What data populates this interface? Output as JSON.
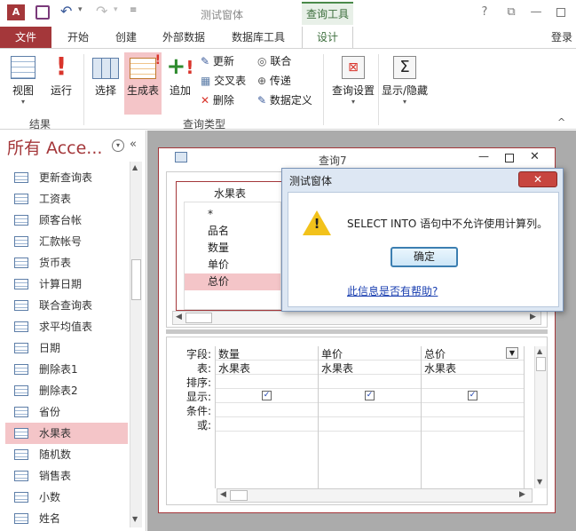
{
  "app": {
    "title": "测试窗体",
    "context_tab_group": "查询工具",
    "login": "登录"
  },
  "ribbon_tabs": [
    "文件",
    "开始",
    "创建",
    "外部数据",
    "数据库工具",
    "设计"
  ],
  "ribbon": {
    "results": {
      "label": "结果",
      "view": "视图",
      "run": "运行"
    },
    "query_type": {
      "label": "查询类型",
      "select": "选择",
      "make_table": "生成表",
      "append": "追加",
      "update": "更新",
      "crosstab": "交叉表",
      "delete": "删除",
      "union": "联合",
      "passthrough": "传递",
      "data_definition": "数据定义"
    },
    "query_setup": "查询设置",
    "show_hide": "显示/隐藏"
  },
  "nav": {
    "title": "所有 Acce...",
    "items": [
      "更新查询表",
      "工资表",
      "顾客台帐",
      "汇款帐号",
      "货币表",
      "计算日期",
      "联合查询表",
      "求平均值表",
      "日期",
      "删除表1",
      "删除表2",
      "省份",
      "水果表",
      "随机数",
      "销售表",
      "小数",
      "姓名"
    ],
    "selected": "水果表"
  },
  "query": {
    "title": "查询7",
    "table_name": "水果表",
    "fields": [
      "*",
      "品名",
      "数量",
      "单价",
      "总价"
    ],
    "selected_field": "总价",
    "row_labels": [
      "字段:",
      "表:",
      "排序:",
      "显示:",
      "条件:",
      "或:"
    ],
    "columns": [
      {
        "field": "数量",
        "table": "水果表",
        "show": true
      },
      {
        "field": "单价",
        "table": "水果表",
        "show": true
      },
      {
        "field": "总价",
        "table": "水果表",
        "show": true
      }
    ]
  },
  "dialog": {
    "title": "测试窗体",
    "message": "SELECT INTO 语句中不允许使用计算列。",
    "ok": "确定",
    "help_link": "此信息是否有帮助?"
  },
  "colors": {
    "accent": "#a4373a",
    "context_green": "#3c6e3c",
    "selection": "#f4c5c8"
  }
}
